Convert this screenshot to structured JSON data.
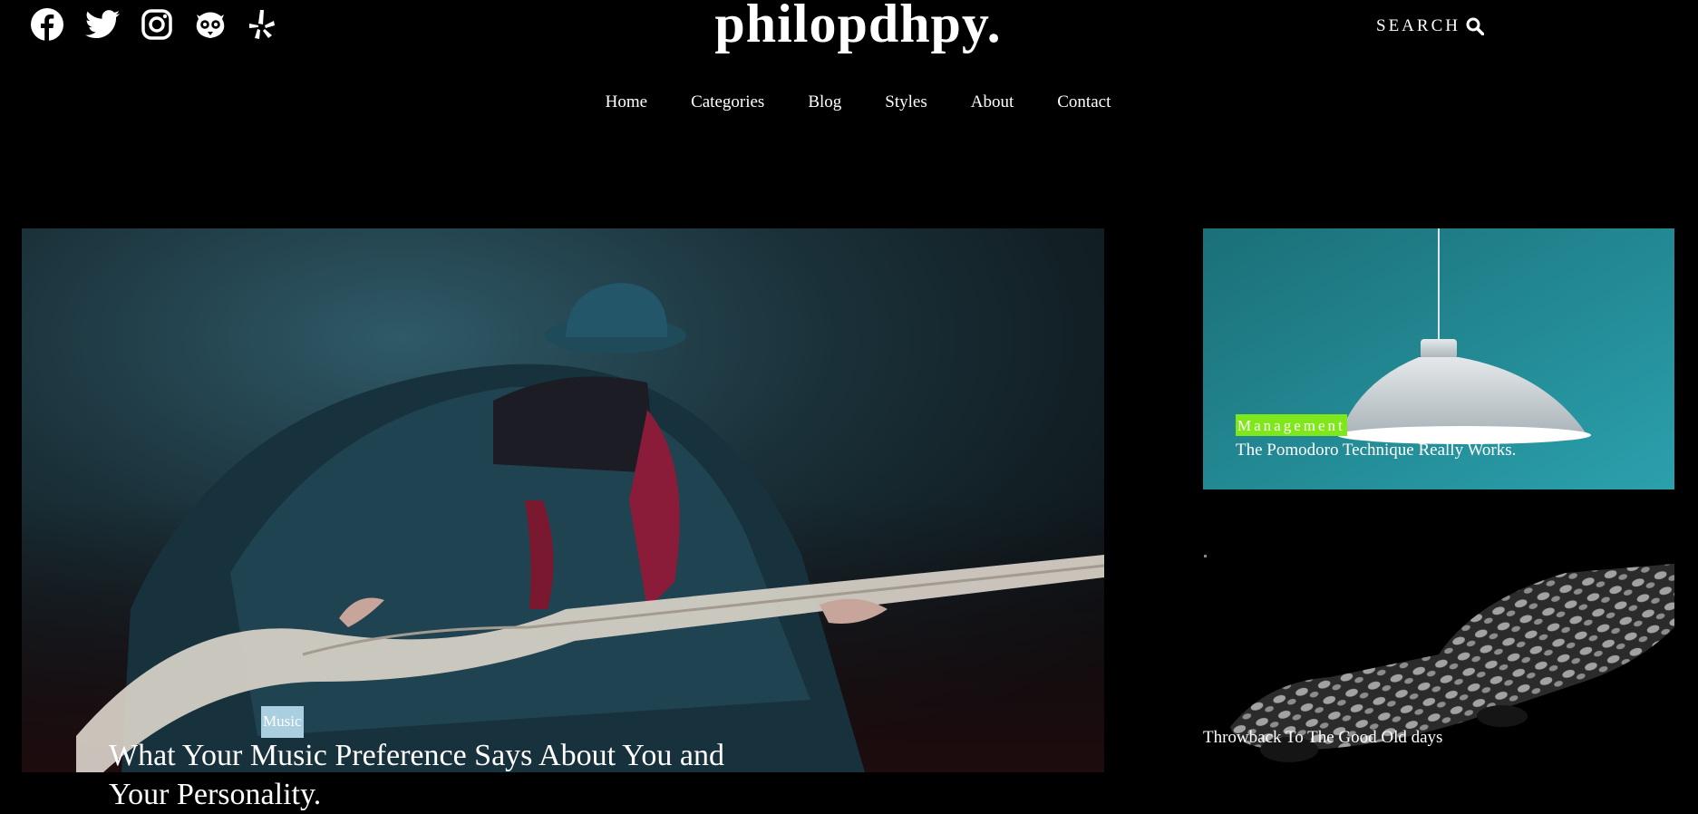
{
  "header": {
    "brand": "philopdhpy.",
    "search_label": "SEARCH",
    "social_icons": [
      "facebook-icon",
      "twitter-icon",
      "instagram-icon",
      "tripadvisor-icon",
      "yelp-icon"
    ]
  },
  "nav": {
    "items": [
      "Home",
      "Categories",
      "Blog",
      "Styles",
      "About",
      "Contact"
    ]
  },
  "featured": {
    "category": "Music",
    "title": "What Your Music Preference Says About You and Your Personality."
  },
  "sidebar": {
    "posts": [
      {
        "category": "Management",
        "title": "The Pomodoro Technique Really Works."
      },
      {
        "title": "Throwback To The Good Old days"
      }
    ]
  },
  "colors": {
    "background": "#000000",
    "music_tag": "#a9cfe0",
    "management_tag": "#7fe81a",
    "card_teal": "#1f8a94"
  }
}
